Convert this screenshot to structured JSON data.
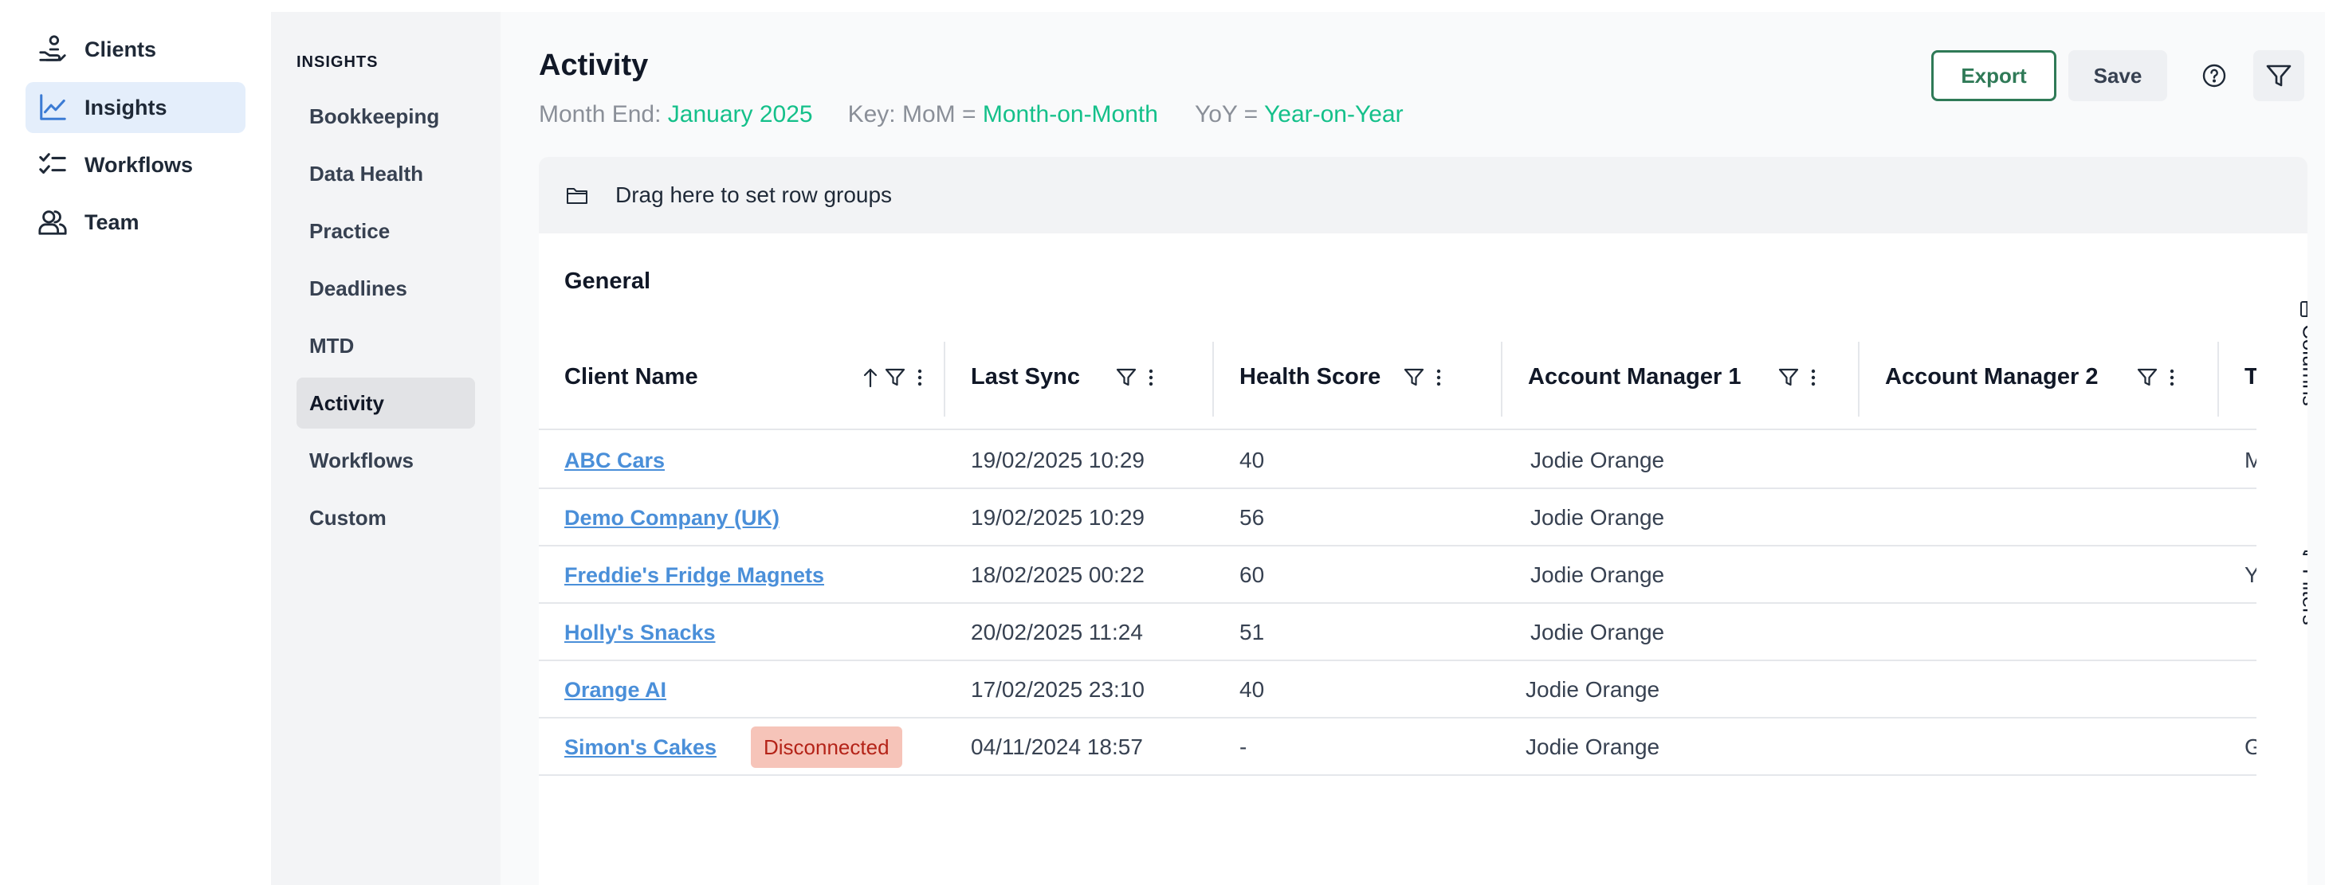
{
  "nav": {
    "items": [
      {
        "label": "Clients",
        "icon": "clients-hand-icon",
        "active": false
      },
      {
        "label": "Insights",
        "icon": "trend-chart-icon",
        "active": true
      },
      {
        "label": "Workflows",
        "icon": "checklist-icon",
        "active": false
      },
      {
        "label": "Team",
        "icon": "team-icon",
        "active": false
      }
    ]
  },
  "subnav": {
    "heading": "INSIGHTS",
    "items": [
      {
        "label": "Bookkeeping"
      },
      {
        "label": "Data Health"
      },
      {
        "label": "Practice"
      },
      {
        "label": "Deadlines"
      },
      {
        "label": "MTD"
      },
      {
        "label": "Activity",
        "active": true
      },
      {
        "label": "Workflows"
      },
      {
        "label": "Custom"
      }
    ]
  },
  "page": {
    "title": "Activity",
    "month_end_label": "Month End:",
    "month_end_value": "January 2025",
    "key_label": "Key: MoM =",
    "key_mom": "Month-on-Month",
    "yoy_label": "YoY =",
    "yoy_value": "Year-on-Year"
  },
  "toolbar": {
    "export_label": "Export",
    "save_label": "Save",
    "help_icon": "help-circle-icon",
    "filter_icon": "filter-icon"
  },
  "grid": {
    "row_group_placeholder": "Drag here to set row groups",
    "group_title": "General",
    "columns": [
      {
        "label": "Client Name"
      },
      {
        "label": "Last Sync"
      },
      {
        "label": "Health Score"
      },
      {
        "label": "Account Manager 1"
      },
      {
        "label": "Account Manager 2"
      },
      {
        "label": "T"
      }
    ],
    "rows": [
      {
        "client": "ABC Cars",
        "last_sync": "19/02/2025 10:29",
        "health": "40",
        "am1": "Jodie Orange",
        "am2": "",
        "extra": "M"
      },
      {
        "client": "Demo Company (UK)",
        "last_sync": "19/02/2025 10:29",
        "health": "56",
        "am1": "Jodie Orange",
        "am2": "",
        "extra": ""
      },
      {
        "client": "Freddie's Fridge Magnets",
        "last_sync": "18/02/2025 00:22",
        "health": "60",
        "am1": "Jodie Orange",
        "am2": "",
        "extra": "Y"
      },
      {
        "client": "Holly's Snacks",
        "last_sync": "20/02/2025 11:24",
        "health": "51",
        "am1": "Jodie Orange",
        "am2": "",
        "extra": ""
      },
      {
        "client": "Orange AI",
        "last_sync": "17/02/2025 23:10",
        "health": "40",
        "am1": "Jodie Orange",
        "am2": "",
        "extra": ""
      },
      {
        "client": "Simon's Cakes",
        "badge": "Disconnected",
        "last_sync": "04/11/2024 18:57",
        "health": "-",
        "am1": "Jodie Orange",
        "am2": "",
        "extra": "G"
      }
    ],
    "side_tabs": {
      "columns": "Columns",
      "filters": "Filters"
    }
  },
  "colors": {
    "accent_green": "#14c08a",
    "link_blue": "#4a8fd9",
    "export_border": "#2f7a57",
    "active_nav_bg": "#e4eefb",
    "badge_bg": "#f6c4b9",
    "badge_text": "#b42318"
  }
}
